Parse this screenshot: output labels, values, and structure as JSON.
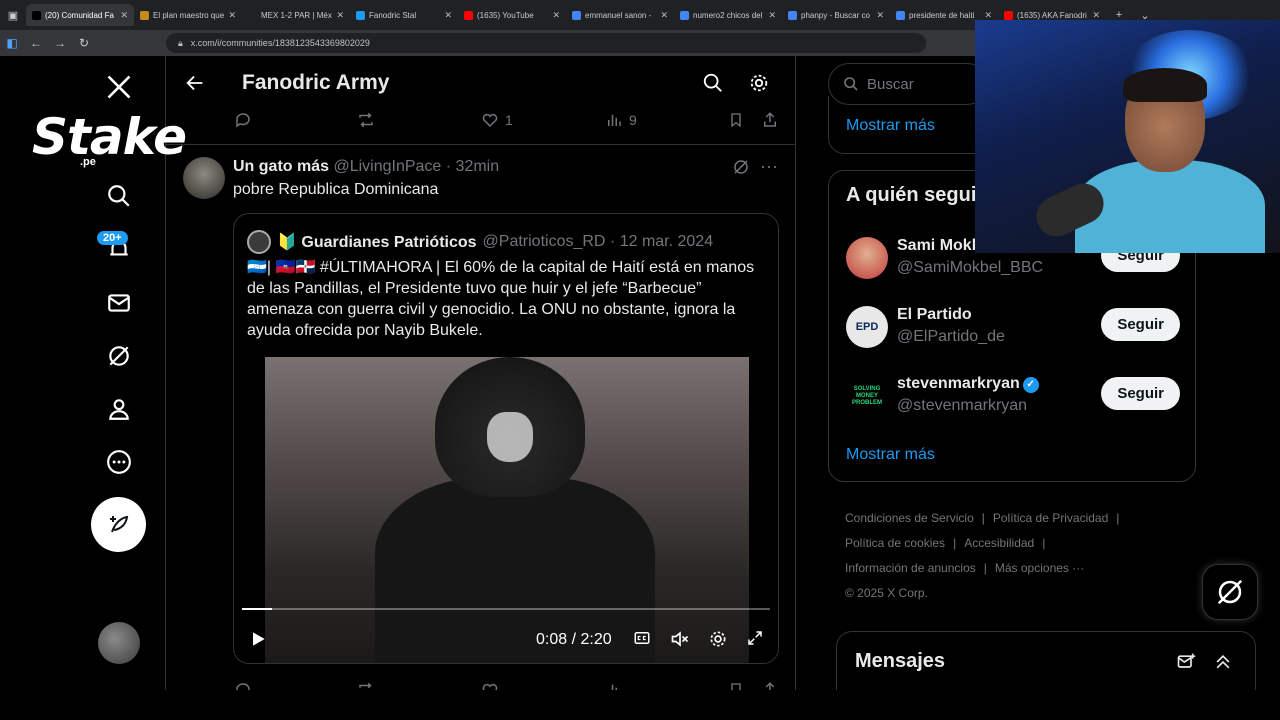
{
  "browser": {
    "tabs": [
      {
        "title": "(20) Comunidad Fa",
        "color": "#000000"
      },
      {
        "title": "El plan maestro que",
        "color": "#c48a1e"
      },
      {
        "title": "MEX 1-2 PAR | Méx",
        "color": "#222222"
      },
      {
        "title": "Fanodric Stal",
        "color": "#1d9bf0"
      },
      {
        "title": "(1635) YouTube",
        "color": "#ff0000"
      },
      {
        "title": "emmanuel sanon -",
        "color": "#4285f4"
      },
      {
        "title": "numero2 chicos del",
        "color": "#4285f4"
      },
      {
        "title": "phanpy - Buscar co",
        "color": "#4285f4"
      },
      {
        "title": "presidente de haiti",
        "color": "#4285f4"
      },
      {
        "title": "(1635) AKA Fanodri",
        "color": "#ff0000"
      }
    ],
    "url": "x.com/i/communities/1838123543369802029"
  },
  "sidebar": {
    "brand": "Stake",
    "brand_suffix": ".pe",
    "notif_badge": "20+"
  },
  "header": {
    "title": "Fanodric Army"
  },
  "prev_actions": {
    "likes": "1",
    "views": "9"
  },
  "tweet": {
    "name": "Un gato más",
    "handle": "@LivingInPace · 32min",
    "text": "pobre Republica Dominicana"
  },
  "quote": {
    "name": "🔰 Guardianes Patrióticos",
    "handle": "@Patrioticos_RD · 12 mar. 2024",
    "text": "🇭🇳| 🇭🇹🇩🇴 #ÚLTIMAHORA | El 60% de la capital de Haití está en manos de las Pandillas, el Presidente tuvo que huir y el jefe “Barbecue” amenaza con guerra civil y genocidio. La ONU no obstante, ignora la ayuda ofrecida por Nayib Bukele.",
    "video_time": "0:08 / 2:20",
    "progress_fraction": 0.057
  },
  "right": {
    "search_placeholder": "Buscar",
    "show_more_top": "Mostrar más",
    "who_title": "A quién seguir",
    "who": [
      {
        "name": "Sami Mokbel",
        "handle": "@SamiMokbel_BBC",
        "follow": "Seguir",
        "verified": false,
        "color": "#c23a3a"
      },
      {
        "name": "El Partido",
        "handle": "@ElPartido_de",
        "follow": "Seguir",
        "verified": false,
        "color": "#e8e8e8"
      },
      {
        "name": "stevenmarkryan",
        "handle": "@stevenmarkryan",
        "follow": "Seguir",
        "verified": true,
        "color": "#0b3d2a"
      }
    ],
    "show_more": "Mostrar más",
    "footer": {
      "terms": "Condiciones de Servicio",
      "privacy": "Política de Privacidad",
      "cookies": "Política de cookies",
      "accessibility": "Accesibilidad",
      "ads": "Información de anuncios",
      "more": "Más opciones ···",
      "copyright": "© 2025 X Corp."
    },
    "messages": "Mensajes"
  }
}
